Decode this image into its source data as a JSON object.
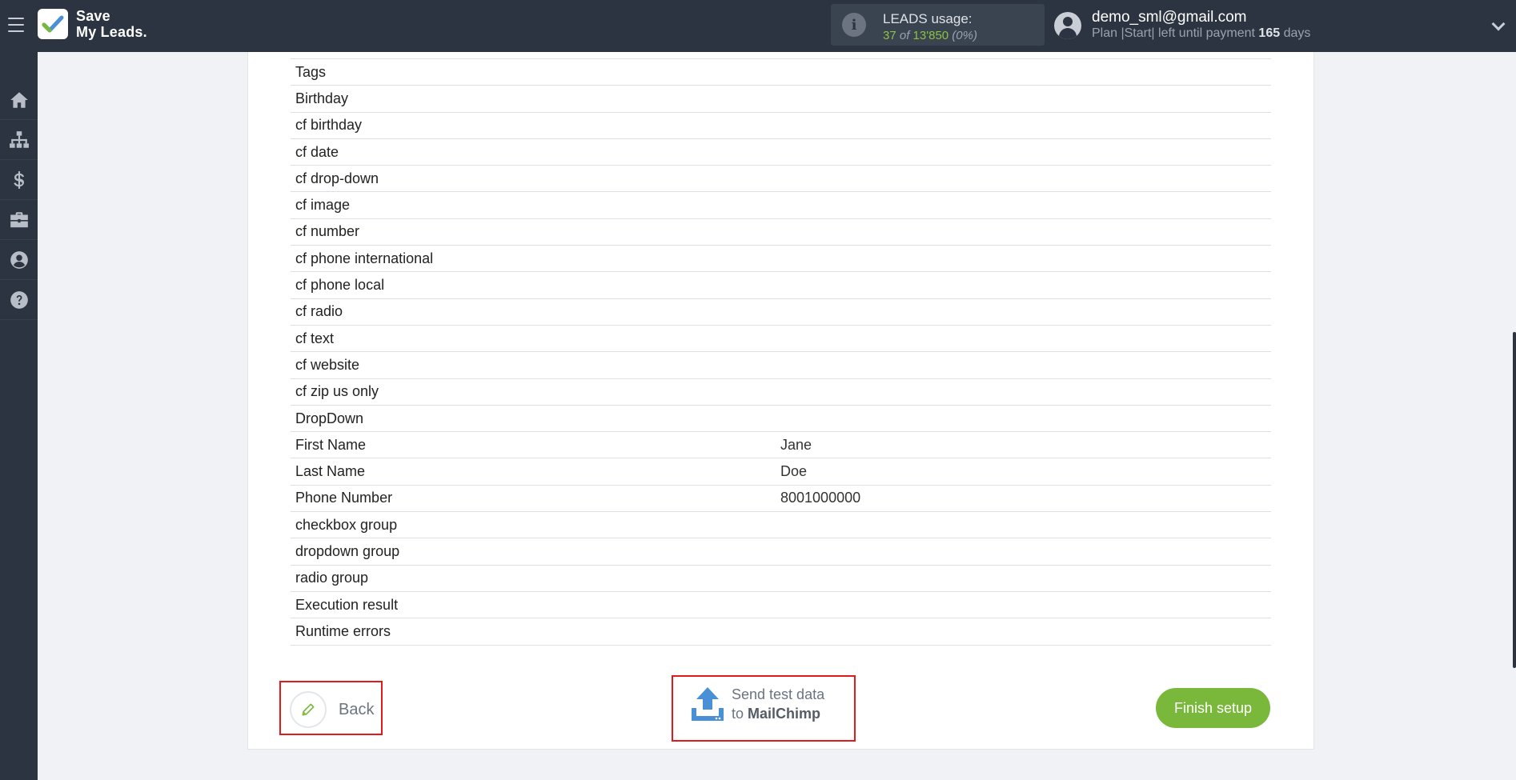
{
  "header": {
    "brand": {
      "line1": "Save",
      "line2": "My Leads."
    },
    "leads_usage": {
      "title": "LEADS usage:",
      "used": "37",
      "of": "of",
      "total": "13'850",
      "percent": "(0%)"
    },
    "user": {
      "email": "demo_sml@gmail.com",
      "plan_prefix": "Plan |Start| left until payment",
      "days": "165",
      "days_suffix": "days"
    }
  },
  "sidebar": {
    "items": [
      {
        "icon": "home-icon"
      },
      {
        "icon": "sitemap-icon"
      },
      {
        "icon": "dollar-icon"
      },
      {
        "icon": "briefcase-icon"
      },
      {
        "icon": "user-circle-icon"
      },
      {
        "icon": "question-icon"
      }
    ]
  },
  "table": {
    "rows": [
      {
        "field": "Tags",
        "value": ""
      },
      {
        "field": "Birthday",
        "value": ""
      },
      {
        "field": "cf birthday",
        "value": ""
      },
      {
        "field": "cf date",
        "value": ""
      },
      {
        "field": "cf drop-down",
        "value": ""
      },
      {
        "field": "cf image",
        "value": ""
      },
      {
        "field": "cf number",
        "value": ""
      },
      {
        "field": "cf phone international",
        "value": ""
      },
      {
        "field": "cf phone local",
        "value": ""
      },
      {
        "field": "cf radio",
        "value": ""
      },
      {
        "field": "cf text",
        "value": ""
      },
      {
        "field": "cf website",
        "value": ""
      },
      {
        "field": "cf zip us only",
        "value": ""
      },
      {
        "field": "DropDown",
        "value": ""
      },
      {
        "field": "First Name",
        "value": "Jane"
      },
      {
        "field": "Last Name",
        "value": "Doe"
      },
      {
        "field": "Phone Number",
        "value": "8001000000"
      },
      {
        "field": "checkbox group",
        "value": ""
      },
      {
        "field": "dropdown group",
        "value": ""
      },
      {
        "field": "radio group",
        "value": ""
      },
      {
        "field": "Execution result",
        "value": ""
      },
      {
        "field": "Runtime errors",
        "value": ""
      }
    ]
  },
  "actions": {
    "back_label": "Back",
    "send_line1": "Send test data",
    "send_line2_prefix": "to",
    "send_line2_target": "MailChimp",
    "finish_label": "Finish setup"
  },
  "colors": {
    "accent_green": "#7ab83b",
    "highlight_red": "#e31a1a",
    "topbar": "#2b3440",
    "upload_blue": "#4a90d6"
  }
}
